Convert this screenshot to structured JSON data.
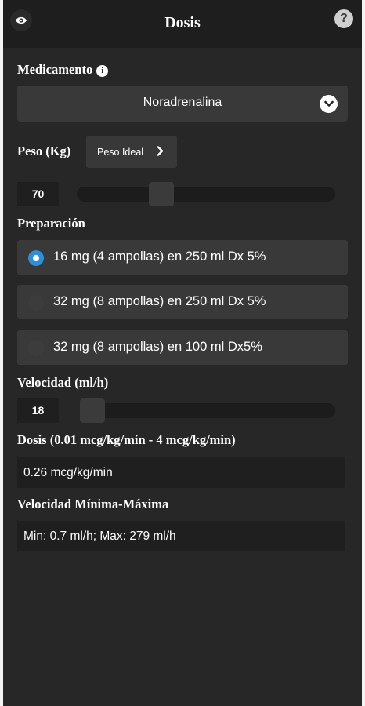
{
  "header": {
    "title": "Dosis",
    "help_label": "?"
  },
  "medicamento": {
    "label": "Medicamento",
    "info_label": "i",
    "selected": "Noradrenalina"
  },
  "peso": {
    "label": "Peso (Kg)",
    "ideal_button": "Peso Ideal",
    "value": "70",
    "slider_fraction": 0.31
  },
  "preparacion": {
    "label": "Preparación",
    "options": [
      {
        "label": "16 mg (4 ampollas) en 250 ml Dx 5%",
        "checked": true
      },
      {
        "label": "32 mg (8 ampollas) en 250 ml Dx 5%",
        "checked": false
      },
      {
        "label": "32 mg (8 ampollas) en 100 ml Dx5%",
        "checked": false
      }
    ]
  },
  "velocidad": {
    "label": "Velocidad (ml/h)",
    "value": "18",
    "slider_fraction": 0.0
  },
  "dosis": {
    "label": "Dosis (0.01 mcg/kg/min - 4 mcg/kg/min)",
    "value": "0.26 mcg/kg/min"
  },
  "velocidad_minmax": {
    "label": "Velocidad Mínima-Máxima",
    "value": "Min: 0.7 ml/h; Max: 279 ml/h"
  },
  "colors": {
    "background": "#272727",
    "header": "#1e1e1e",
    "accent": "#2f8fd6"
  }
}
